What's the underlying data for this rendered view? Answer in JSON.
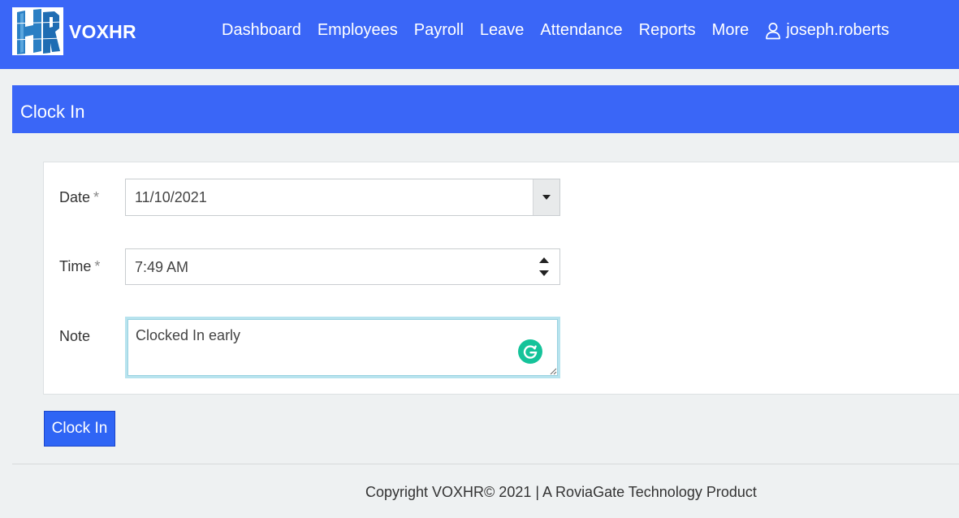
{
  "brand": {
    "logo_text": "HR",
    "name": "VOXHR"
  },
  "nav": {
    "items": [
      {
        "label": "Dashboard"
      },
      {
        "label": "Employees"
      },
      {
        "label": "Payroll"
      },
      {
        "label": "Leave"
      },
      {
        "label": "Attendance"
      },
      {
        "label": "Reports"
      },
      {
        "label": "More"
      }
    ],
    "user": {
      "icon": "user-icon",
      "name": "joseph.roberts"
    }
  },
  "panel": {
    "title": "Clock In"
  },
  "form": {
    "date": {
      "label": "Date",
      "required_marker": "*",
      "value": "11/10/2021",
      "icon": "caret-down-icon"
    },
    "time": {
      "label": "Time",
      "required_marker": "*",
      "value": "7:49 AM",
      "icon": "spinner-arrows-icon"
    },
    "note": {
      "label": "Note",
      "value": "Clocked In early",
      "icon": "grammarly-icon"
    },
    "submit_label": "Clock In"
  },
  "footer": {
    "text": "Copyright VOXHR© 2021 | A RoviaGate Technology Product"
  },
  "colors": {
    "primary": "#3a66f7",
    "button": "#2f65f5",
    "background": "#eef1f2",
    "grammarly": "#15c39a"
  }
}
